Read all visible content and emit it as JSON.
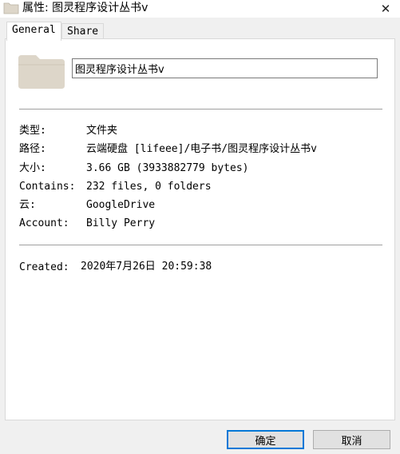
{
  "window": {
    "title": "属性: 图灵程序设计丛书v",
    "close_glyph": "✕"
  },
  "tabs": [
    {
      "label": "General",
      "active": true
    },
    {
      "label": "Share",
      "active": false
    }
  ],
  "general": {
    "folder_name": "图灵程序设计丛书v",
    "properties": [
      {
        "label": "类型:",
        "value": "文件夹"
      },
      {
        "label": "路径:",
        "value": "云端硬盘 [lifeee]/电子书/图灵程序设计丛书v"
      },
      {
        "label": "大小:",
        "value": "3.66 GB (3933882779 bytes)"
      },
      {
        "label": "Contains:",
        "value": "232 files, 0 folders"
      },
      {
        "label": "云:",
        "value": "GoogleDrive"
      },
      {
        "label": "Account:",
        "value": "Billy Perry"
      }
    ],
    "created": {
      "label": "Created:",
      "value": "2020年7月26日 20:59:38"
    }
  },
  "buttons": {
    "ok_label": "确定",
    "cancel_label": "取消"
  },
  "colors": {
    "folder": "#ddd6c9",
    "accent": "#0078d7"
  }
}
